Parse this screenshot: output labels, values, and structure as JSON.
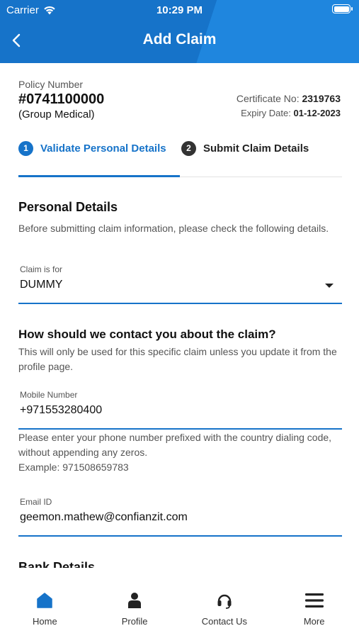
{
  "status_bar": {
    "carrier": "Carrier",
    "time": "10:29 PM"
  },
  "header": {
    "title": "Add Claim",
    "back_icon": "chevron-left-icon"
  },
  "policy": {
    "label": "Policy Number",
    "number": "#0741100000",
    "type": "(Group Medical)",
    "certificate_label": "Certificate No:",
    "certificate_no": "2319763",
    "expiry_label": "Expiry Date:",
    "expiry_date": "01-12-2023"
  },
  "stepper": {
    "steps": [
      {
        "num": "1",
        "label": "Validate Personal Details",
        "active": true
      },
      {
        "num": "2",
        "label": "Submit Claim Details",
        "active": false
      }
    ]
  },
  "personal": {
    "title": "Personal Details",
    "subtitle": "Before submitting claim information, please check the following details.",
    "claim_for_label": "Claim is for",
    "claim_for_value": "DUMMY"
  },
  "contact": {
    "title": "How should we contact you about the claim?",
    "subtitle": "This will only be used for this specific claim unless you update it from the profile page.",
    "mobile_label": "Mobile Number",
    "mobile_value": "+971553280400",
    "mobile_helper": "Please enter your phone number prefixed with the country dialing code, without appending any zeros.",
    "mobile_example": "Example: 971508659783",
    "email_label": "Email ID",
    "email_value": "geemon.mathew@confianzit.com"
  },
  "bank": {
    "title": "Bank Details"
  },
  "nav": {
    "items": [
      {
        "label": "Home",
        "icon": "home-icon",
        "active": true
      },
      {
        "label": "Profile",
        "icon": "person-icon",
        "active": false
      },
      {
        "label": "Contact Us",
        "icon": "headset-icon",
        "active": false
      },
      {
        "label": "More",
        "icon": "menu-icon",
        "active": false
      }
    ]
  },
  "colors": {
    "primary": "#1673c9",
    "text": "#111111",
    "muted": "#555555"
  }
}
